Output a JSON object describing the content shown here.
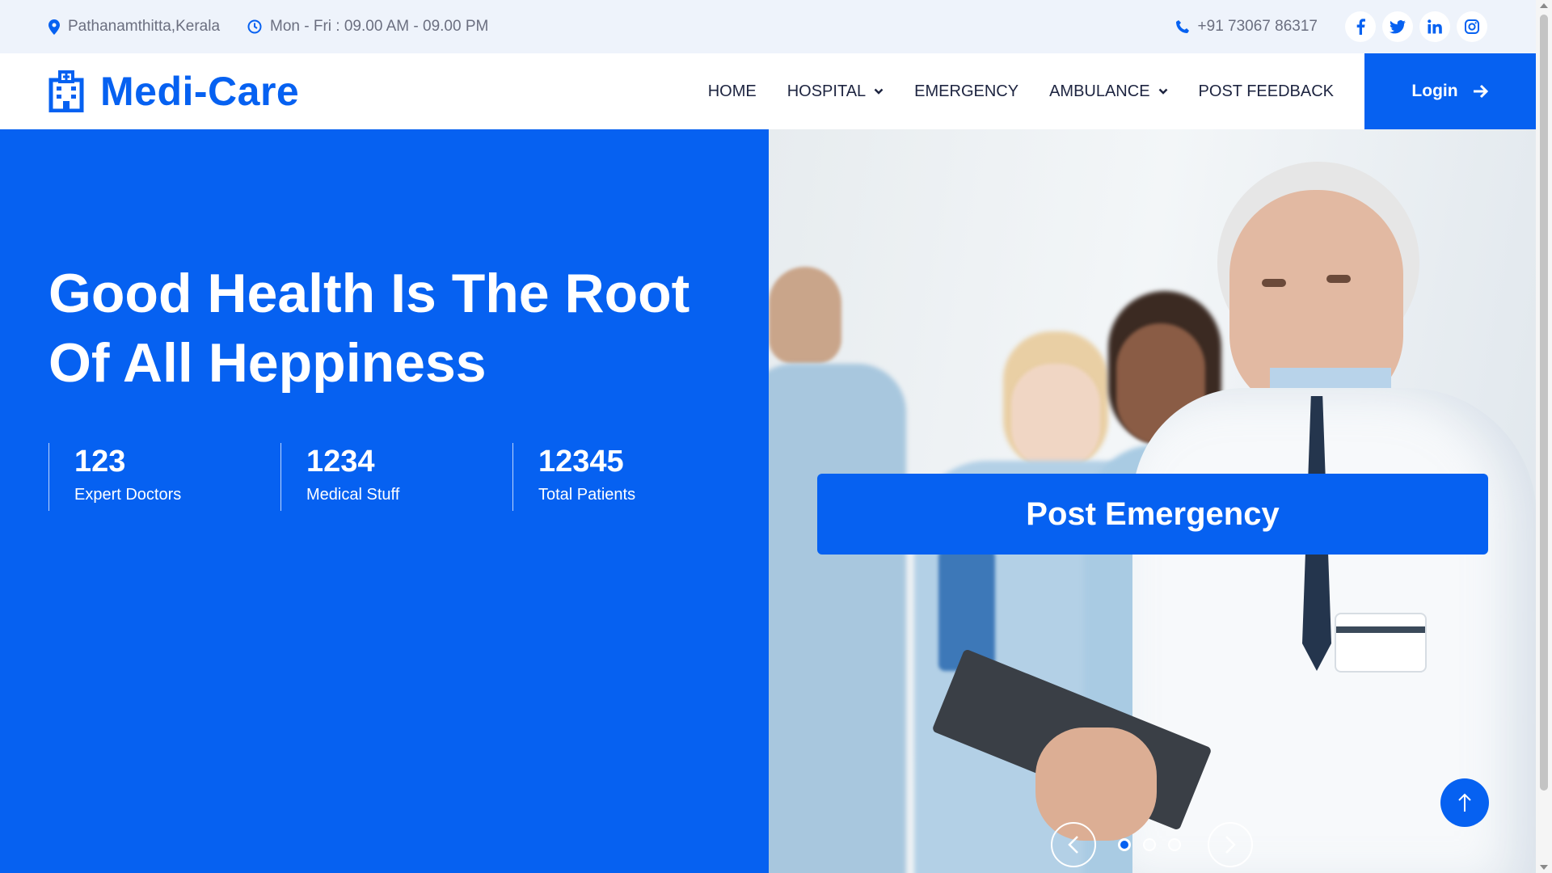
{
  "topbar": {
    "location": "Pathanamthitta,Kerala",
    "hours": "Mon - Fri : 09.00 AM - 09.00 PM",
    "phone": "+91 73067 86317",
    "social": [
      {
        "name": "facebook-icon",
        "glyph": "f"
      },
      {
        "name": "twitter-icon",
        "glyph": "t"
      },
      {
        "name": "linkedin-icon",
        "glyph": "in"
      },
      {
        "name": "instagram-icon",
        "glyph": "ig"
      }
    ]
  },
  "brand": {
    "name": "Medi-Care"
  },
  "nav": {
    "items": [
      "HOME",
      "HOSPITAL",
      "EMERGENCY",
      "AMBULANCE",
      "POST FEEDBACK"
    ],
    "login": "Login"
  },
  "hero": {
    "title_line1": "Good Health Is The Root",
    "title_line2": "Of All Heppiness",
    "stats": [
      {
        "value": "123",
        "label": "Expert Doctors"
      },
      {
        "value": "1234",
        "label": "Medical Stuff"
      },
      {
        "value": "12345",
        "label": "Total Patients"
      }
    ],
    "emergency_button": "Post Emergency"
  },
  "carousel": {
    "slides": 3,
    "active": 1
  },
  "colors": {
    "primary": "#0661f1",
    "topbar_bg": "#eef3fb",
    "nav_text": "#1d2440"
  }
}
